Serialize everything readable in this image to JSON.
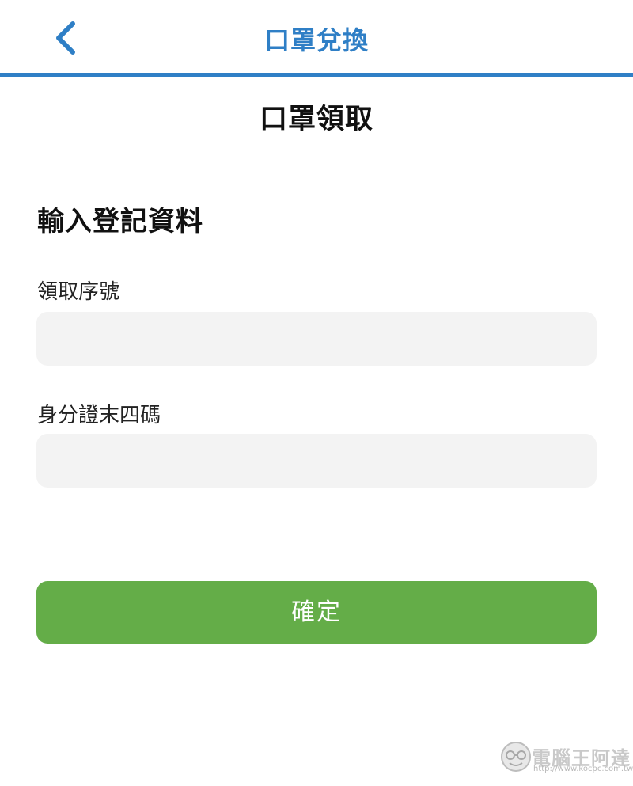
{
  "nav": {
    "title": "口罩兌換",
    "back_icon": "chevron-left-icon",
    "accent_color": "#2f7fc6"
  },
  "page_title": "口罩領取",
  "form": {
    "section_title": "輸入登記資料",
    "fields": [
      {
        "label": "領取序號",
        "value": "",
        "placeholder": ""
      },
      {
        "label": "身分證末四碼",
        "value": "",
        "placeholder": ""
      }
    ],
    "submit_label": "確定",
    "submit_color": "#64ad48"
  },
  "watermark": {
    "text": "電腦王阿達",
    "url": "http://www.kocpc.com.tw"
  }
}
